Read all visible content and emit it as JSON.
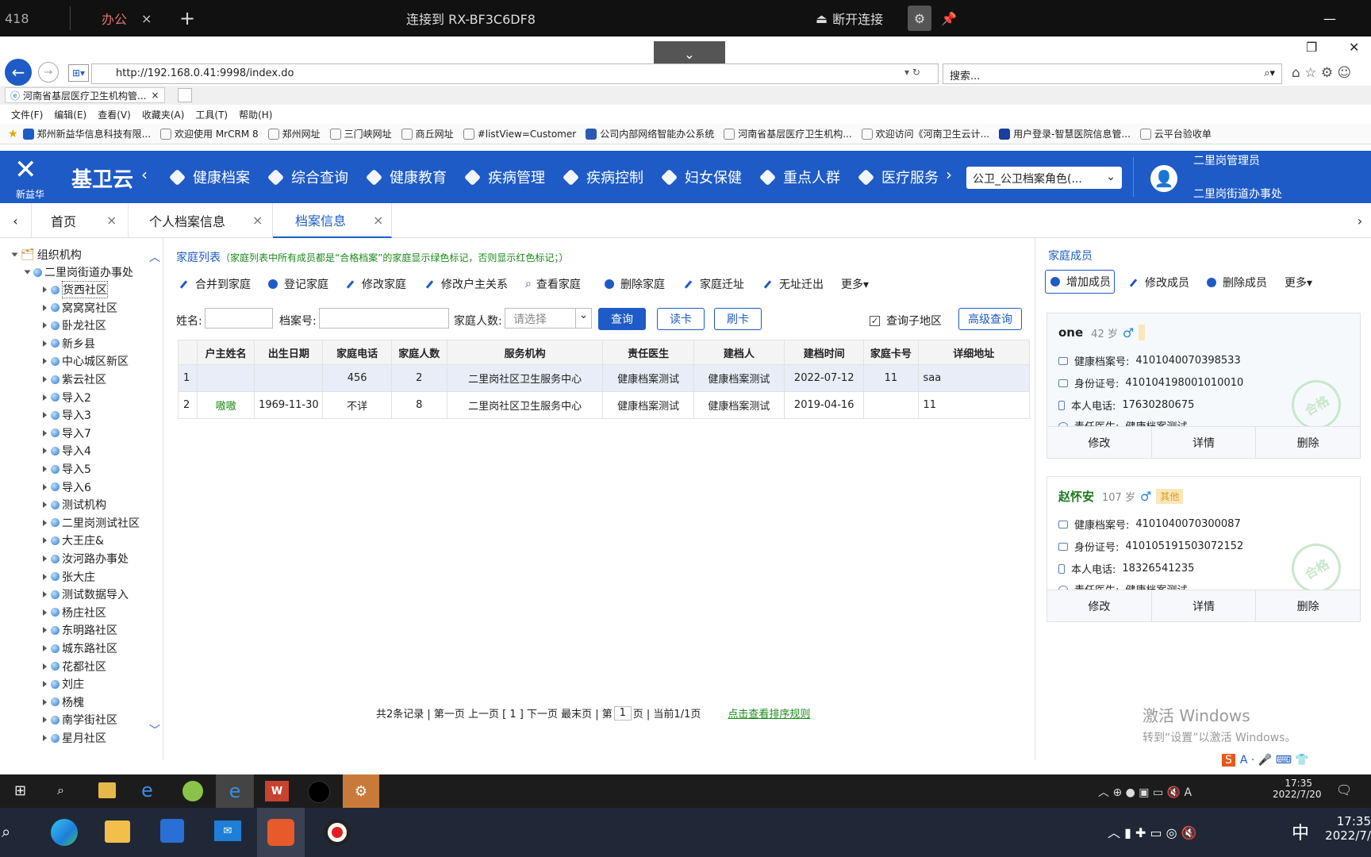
{
  "remote": {
    "tab_left_num": "418",
    "tab_office": "办公",
    "tab_close": "×",
    "tab_add": "+",
    "connection_title": "连接到 RX-BF3C6DF8",
    "disconnect": "断开连接",
    "minimize": "—",
    "maximize": "☐",
    "close": "✕"
  },
  "browser": {
    "url": "http://192.168.0.41:9998/index.do",
    "search_placeholder": "搜索...",
    "tab_title": "河南省基层医疗卫生机构管...",
    "menu": [
      "文件(F)",
      "编辑(E)",
      "查看(V)",
      "收藏夹(A)",
      "工具(T)",
      "帮助(H)"
    ],
    "favorites": [
      "郑州新益华信息科技有限...",
      "欢迎使用 MrCRM 8",
      "郑州网址",
      "三门峡网址",
      "商丘网址",
      "#listView=Customer",
      "公司内部网络智能办公系统",
      "河南省基层医疗卫生机构...",
      "欢迎访问《河南卫生云计...",
      "用户登录-智慧医院信息管...",
      "云平台验收单"
    ]
  },
  "app": {
    "logo_sub": "新益华",
    "brand": "基卫云",
    "nav": [
      "健康档案",
      "综合查询",
      "健康教育",
      "疾病管理",
      "疾病控制",
      "妇女保健",
      "重点人群",
      "医疗服务"
    ],
    "role_select": "公卫_公卫档案角色(...",
    "user_name": "二里岗管理员",
    "user_org": "二里岗街道办事处"
  },
  "page_tabs": [
    "首页",
    "个人档案信息",
    "档案信息"
  ],
  "tree": {
    "root": "组织机构",
    "org": "二里岗街道办事处",
    "items": [
      "货西社区",
      "窝窝窝社区",
      "卧龙社区",
      "新乡县",
      "中心城区新区",
      "紫云社区",
      "导入2",
      "导入3",
      "导入7",
      "导入4",
      "导入5",
      "导入6",
      "测试机构",
      "二里岗测试社区",
      "大王庄&",
      "汝河路办事处",
      "张大庄",
      "测试数据导入",
      "杨庄社区",
      "东明路社区",
      "城东路社区",
      "花都社区",
      "刘庄",
      "杨槐",
      "南学街社区",
      "星月社区"
    ]
  },
  "family": {
    "title": "家庭列表",
    "note": "（家庭列表中所有成员都是“合格档案”的家庭显示绿色标记，否则显示红色标记；）",
    "toolbar": [
      "合并到家庭",
      "登记家庭",
      "修改家庭",
      "修改户主关系",
      "查看家庭",
      "删除家庭",
      "家庭迁址",
      "无址迁出",
      "更多▾"
    ],
    "label_name": "姓名:",
    "label_record": "档案号:",
    "label_count": "家庭人数:",
    "count_placeholder": "请选择",
    "btn_query": "查询",
    "btn_read": "读卡",
    "btn_swipe": "刷卡",
    "check_sub": "查询子地区",
    "btn_adv": "高级查询",
    "columns": [
      "",
      "户主姓名",
      "出生日期",
      "家庭电话",
      "家庭人数",
      "服务机构",
      "责任医生",
      "建档人",
      "建档时间",
      "家庭卡号",
      "详细地址"
    ],
    "rows": [
      [
        "1",
        "",
        "",
        "456",
        "2",
        "二里岗社区卫生服务中心",
        "健康档案测试",
        "健康档案测试",
        "2022-07-12",
        "11",
        "saa"
      ],
      [
        "2",
        "嗷嗷",
        "1969-11-30",
        "不详",
        "8",
        "二里岗社区卫生服务中心",
        "健康档案测试",
        "健康档案测试",
        "2019-04-16",
        "",
        "11"
      ]
    ],
    "pager_left": "共2条记录 | 第一页 上一页 [ 1 ] 下一页 最末页 | 第",
    "pager_page": "1",
    "pager_right": "页 | 当前1/1页",
    "pager_rule": "点击查看排序规则"
  },
  "members": {
    "title": "家庭成员",
    "btn_add": "增加成员",
    "btn_edit": "修改成员",
    "btn_del": "删除成员",
    "btn_more": "更多▾",
    "cards": [
      {
        "name": "one",
        "age": "42 岁",
        "sex": "♂",
        "tag": "",
        "record_label": "健康档案号:",
        "record": "4101040070398533",
        "id_label": "身份证号:",
        "id": "410104198001010010",
        "phone_label": "本人电话:",
        "phone": "17630280675",
        "doctor_label": "责任医生:",
        "doctor": "健康档案测试",
        "stamp": "合格",
        "a_edit": "修改",
        "a_detail": "详情",
        "a_delete": "删除"
      },
      {
        "name": "赵怀安",
        "age": "107 岁",
        "sex": "♂",
        "tag": "其他",
        "record_label": "健康档案号:",
        "record": "4101040070300087",
        "id_label": "身份证号:",
        "id": "410105191503072152",
        "phone_label": "本人电话:",
        "phone": "18326541235",
        "doctor_label": "责任医生:",
        "doctor": "健康档案测试",
        "stamp": "合格",
        "a_edit": "修改",
        "a_detail": "详情",
        "a_delete": "删除"
      }
    ]
  },
  "watermark": {
    "line1": "激活 Windows",
    "line2": "转到“设置”以激活 Windows。"
  },
  "taskbar_inner": {
    "time": "17:35",
    "date": "2022/7/20"
  },
  "taskbar_outer": {
    "time": "17:35",
    "date": "2022/7/",
    "ime": "中"
  },
  "colors": {
    "brand_blue": "#1e5bc6",
    "green_text": "#1a8a1a",
    "name_green": "#1a7a1a"
  }
}
